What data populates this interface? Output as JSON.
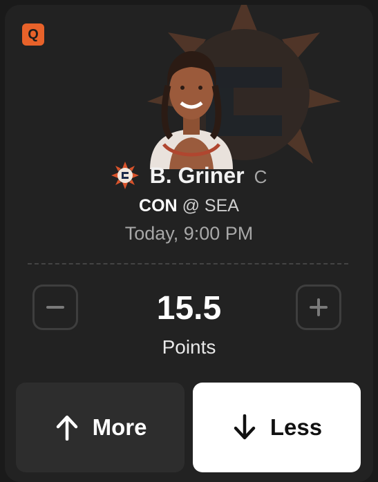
{
  "card": {
    "badge_letter": "Q",
    "badge_color": "#e8622a"
  },
  "player": {
    "name": "B. Griner",
    "position": "C",
    "team_logo_icon": "sun-team-logo-icon",
    "headshot": "player-headshot"
  },
  "matchup": {
    "team": "CON",
    "separator": "@",
    "opponent": "SEA"
  },
  "game_time": "Today, 9:00 PM",
  "projection": {
    "value": "15.5",
    "stat": "Points"
  },
  "buttons": {
    "more_label": "More",
    "less_label": "Less"
  }
}
